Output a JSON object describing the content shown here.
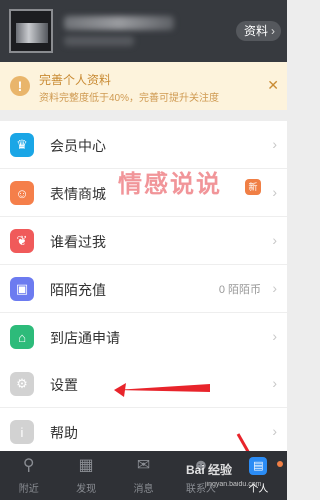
{
  "header": {
    "profile_button": "资料"
  },
  "banner": {
    "title": "完善个人资料",
    "subtitle": "资料完整度低于40%，完善可提升关注度",
    "close": "✕"
  },
  "menu_group1": [
    {
      "label": "会员中心",
      "icon": "crown-icon",
      "color": "#1aa6e6",
      "glyph": "♛"
    },
    {
      "label": "表情商城",
      "icon": "smile-icon",
      "color": "#f57f4a",
      "glyph": "☺"
    },
    {
      "label": "谁看过我",
      "icon": "footprint-icon",
      "color": "#f05a5a",
      "glyph": "❦"
    },
    {
      "label": "陌陌充值",
      "icon": "wallet-icon",
      "color": "#6c7bf0",
      "glyph": "▣",
      "value": "0 陌陌币"
    },
    {
      "label": "到店通申请",
      "icon": "store-icon",
      "color": "#2dbb7a",
      "glyph": "⌂"
    }
  ],
  "menu_group2": [
    {
      "label": "设置",
      "icon": "gear-icon",
      "color": "#c9c9c9",
      "glyph": "⚙"
    },
    {
      "label": "帮助",
      "icon": "info-icon",
      "color": "#c9c9c9",
      "glyph": "i"
    }
  ],
  "watermark": "情感说说",
  "new_badge": "新",
  "bottom_nav": [
    {
      "label": "附近",
      "icon": "location-icon",
      "glyph": "⚲"
    },
    {
      "label": "发现",
      "icon": "grid-icon",
      "glyph": "▦"
    },
    {
      "label": "消息",
      "icon": "chat-icon",
      "glyph": "💬"
    },
    {
      "label": "联系人",
      "icon": "contacts-icon",
      "glyph": "👥"
    },
    {
      "label": "个人",
      "icon": "person-icon",
      "glyph": "▤",
      "active": true
    }
  ],
  "baidu_watermark": "Bai 经验",
  "baidu_url": "jingyan.baidu.com"
}
